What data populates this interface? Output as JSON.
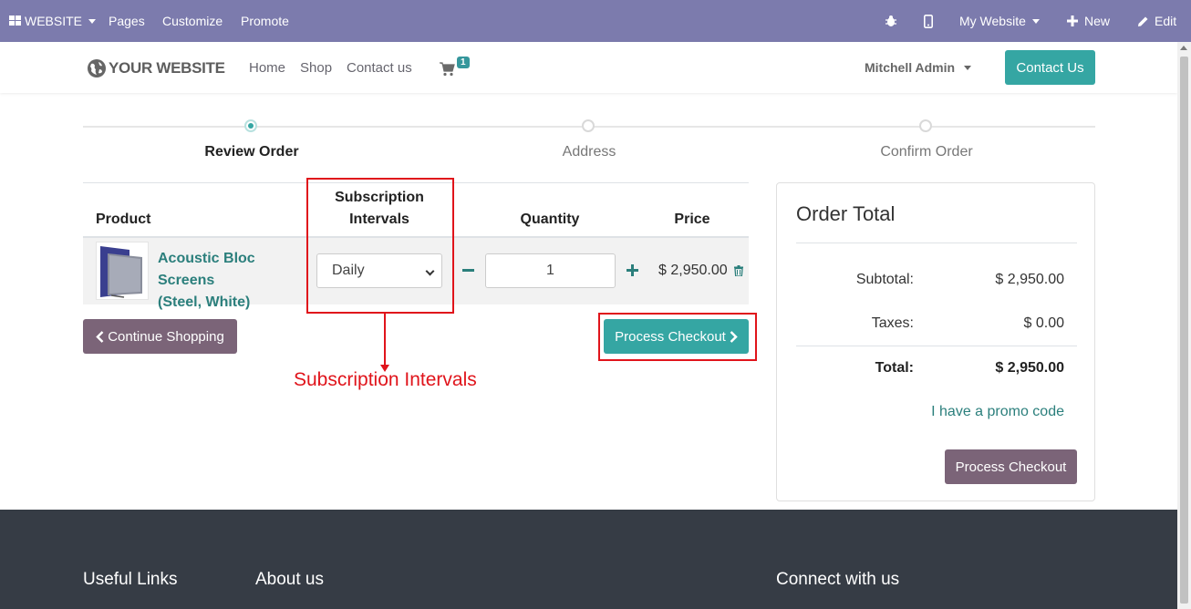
{
  "adminbar": {
    "website_label": "WEBSITE",
    "pages": "Pages",
    "customize": "Customize",
    "promote": "Promote",
    "my_website": "My Website",
    "new": "New",
    "edit": "Edit"
  },
  "navbar": {
    "logo_text": "YOUR WEBSITE",
    "links": [
      "Home",
      "Shop",
      "Contact us"
    ],
    "cart_count": "1",
    "user": "Mitchell Admin",
    "contact_button": "Contact Us"
  },
  "steps": [
    {
      "label": "Review Order",
      "active": true
    },
    {
      "label": "Address",
      "active": false
    },
    {
      "label": "Confirm Order",
      "active": false
    }
  ],
  "table": {
    "headers": {
      "product": "Product",
      "subscription_line1": "Subscription",
      "subscription_line2": "Intervals",
      "quantity": "Quantity",
      "price": "Price"
    },
    "row": {
      "product_line1": "Acoustic Bloc Screens",
      "product_line2": "(Steel, White)",
      "interval": "Daily",
      "quantity": "1",
      "price": "$ 2,950.00"
    }
  },
  "buttons": {
    "continue_shopping": "Continue Shopping",
    "process_checkout": "Process Checkout"
  },
  "annotation": {
    "label": "Subscription Intervals",
    "color": "#e0141b"
  },
  "order_total": {
    "title": "Order Total",
    "subtotal_label": "Subtotal:",
    "subtotal_value": "$ 2,950.00",
    "taxes_label": "Taxes:",
    "taxes_value": "$ 0.00",
    "total_label": "Total:",
    "total_value": "$ 2,950.00",
    "promo": "I have a promo code",
    "process_checkout": "Process Checkout"
  },
  "footer": {
    "useful_links": "Useful Links",
    "about_us": "About us",
    "connect": "Connect with us"
  },
  "colors": {
    "adminbar": "#7c7bad",
    "primary": "#35a6a3",
    "secondary": "#7b6478",
    "link": "#2b7f7c",
    "footer": "#363c45"
  }
}
